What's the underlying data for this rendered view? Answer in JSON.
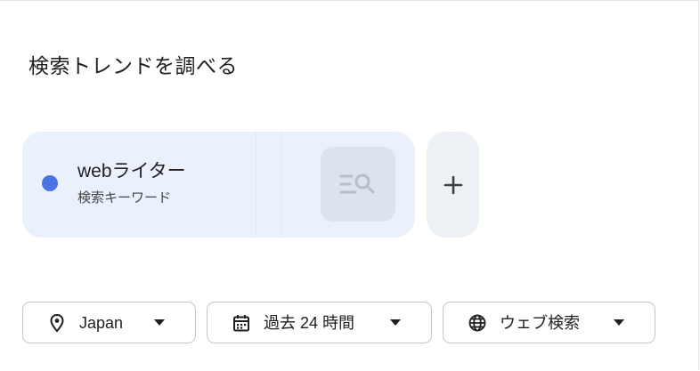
{
  "page": {
    "title": "検索トレンドを調べる"
  },
  "term_card": {
    "term": "webライター",
    "subtitle": "検索キーワード",
    "dot_color": "#4b73e3",
    "search_type_icon": "search-list-icon"
  },
  "add_button": {
    "icon": "plus-icon"
  },
  "filters": {
    "location": {
      "label": "Japan",
      "icon": "location-pin-icon"
    },
    "time": {
      "label": "過去 24 時間",
      "icon": "calendar-icon"
    },
    "property": {
      "label": "ウェブ検索",
      "icon": "globe-icon"
    }
  },
  "colors": {
    "card_background": "#eaf1fd",
    "accent_blue": "#4b73e3",
    "button_background": "#edf0f4",
    "border": "#c4c7c5"
  }
}
